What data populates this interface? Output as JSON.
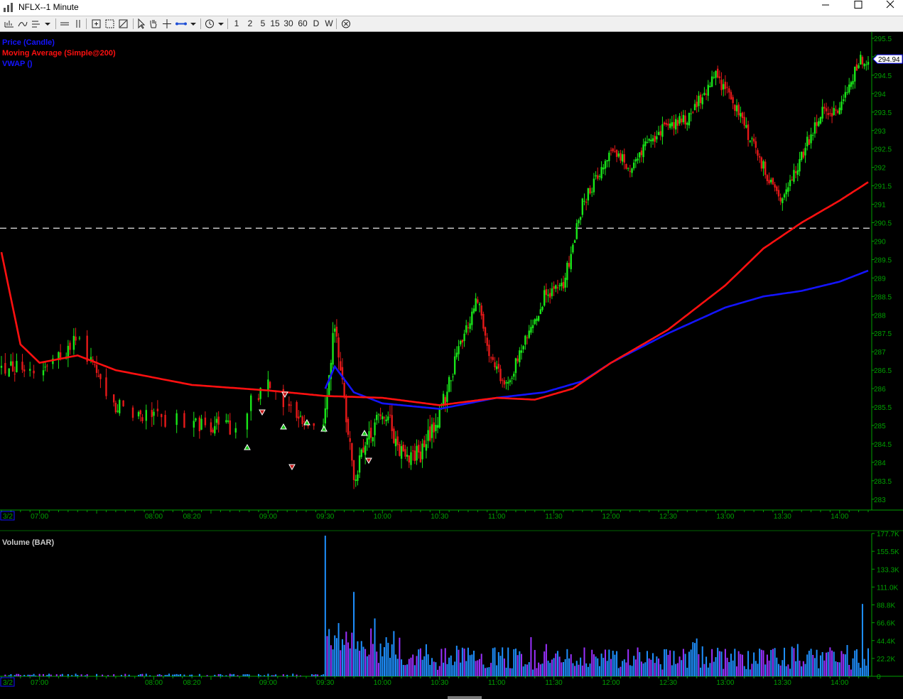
{
  "window": {
    "title": "NFLX--1 Minute"
  },
  "toolbar": {
    "intervals": [
      "1",
      "2",
      "5",
      "15",
      "30",
      "60",
      "D",
      "W"
    ]
  },
  "price_pane": {
    "legend": [
      {
        "label": "Price (Candle)",
        "color": "#1414ff"
      },
      {
        "label": "Moving Average (Simple@200)",
        "color": "#ff1010"
      },
      {
        "label": "VWAP ()",
        "color": "#1414ff"
      }
    ],
    "last_price": "294.94",
    "y_ticks": [
      "295.5",
      "295",
      "294.5",
      "294",
      "293.5",
      "293",
      "292.5",
      "292",
      "291.5",
      "291",
      "290.5",
      "290",
      "289.5",
      "289",
      "288.5",
      "288",
      "287.5",
      "287",
      "286.5",
      "286",
      "285.5",
      "285",
      "284.5",
      "284",
      "283.5",
      "283"
    ],
    "date_label": "3/2",
    "time_ticks": [
      "07:00",
      "08:00",
      "08:20",
      "09:00",
      "09:30",
      "10:00",
      "10:30",
      "11:00",
      "11:30",
      "12:00",
      "12:30",
      "13:00",
      "13:30",
      "14:00"
    ]
  },
  "volume_pane": {
    "title": "Volume (BAR)",
    "y_ticks": [
      "177.7K",
      "155.5K",
      "133.3K",
      "111.0K",
      "88.8K",
      "66.6K",
      "44.4K",
      "22.2K",
      "0"
    ],
    "date_label": "3/2",
    "time_ticks": [
      "07:00",
      "08:00",
      "08:20",
      "09:00",
      "09:30",
      "10:00",
      "10:30",
      "11:00",
      "11:30",
      "12:00",
      "12:30",
      "13:00",
      "13:30",
      "14:00"
    ]
  },
  "colors": {
    "up": "#19e619",
    "down": "#e61919",
    "ma": "#ff1010",
    "vwap": "#1414ff",
    "axis": "#00a000",
    "volume_a": "#1e90ff",
    "volume_b": "#9b30ff",
    "price_flag": "#ffffff"
  },
  "chart_data": {
    "type": "candlestick",
    "symbol": "NFLX",
    "interval": "1 Minute",
    "date": "3/2",
    "price_ylim": [
      282.8,
      295.7
    ],
    "volume_ylim": [
      0,
      177700
    ],
    "last_price": 294.94,
    "horizontal_line": 290.35,
    "price_path": [
      {
        "time": "06:40",
        "price": 286.6
      },
      {
        "time": "07:00",
        "price": 286.6
      },
      {
        "time": "07:20",
        "price": 287.3
      },
      {
        "time": "07:40",
        "price": 285.5
      },
      {
        "time": "08:00",
        "price": 285.2
      },
      {
        "time": "08:20",
        "price": 285.1
      },
      {
        "time": "08:40",
        "price": 284.9
      },
      {
        "time": "09:00",
        "price": 286.2
      },
      {
        "time": "09:20",
        "price": 285.0
      },
      {
        "time": "09:30",
        "price": 285.2
      },
      {
        "time": "09:35",
        "price": 287.8
      },
      {
        "time": "09:45",
        "price": 283.6
      },
      {
        "time": "10:00",
        "price": 285.5
      },
      {
        "time": "10:10",
        "price": 284.3
      },
      {
        "time": "10:20",
        "price": 284.2
      },
      {
        "time": "10:30",
        "price": 285.3
      },
      {
        "time": "10:40",
        "price": 287.0
      },
      {
        "time": "10:50",
        "price": 288.5
      },
      {
        "time": "10:55",
        "price": 287.0
      },
      {
        "time": "11:05",
        "price": 286.0
      },
      {
        "time": "11:15",
        "price": 287.3
      },
      {
        "time": "11:25",
        "price": 288.5
      },
      {
        "time": "11:35",
        "price": 288.8
      },
      {
        "time": "11:45",
        "price": 291.0
      },
      {
        "time": "12:00",
        "price": 292.5
      },
      {
        "time": "12:10",
        "price": 292.0
      },
      {
        "time": "12:25",
        "price": 293.0
      },
      {
        "time": "12:40",
        "price": 293.3
      },
      {
        "time": "12:55",
        "price": 294.5
      },
      {
        "time": "13:05",
        "price": 293.7
      },
      {
        "time": "13:20",
        "price": 292.0
      },
      {
        "time": "13:30",
        "price": 291.0
      },
      {
        "time": "13:40",
        "price": 292.3
      },
      {
        "time": "13:50",
        "price": 293.5
      },
      {
        "time": "14:00",
        "price": 293.5
      },
      {
        "time": "14:10",
        "price": 294.9
      },
      {
        "time": "14:15",
        "price": 294.94
      }
    ],
    "moving_average_200": [
      {
        "time": "06:40",
        "value": 289.7
      },
      {
        "time": "06:50",
        "value": 287.2
      },
      {
        "time": "07:00",
        "value": 286.7
      },
      {
        "time": "07:20",
        "value": 286.9
      },
      {
        "time": "07:40",
        "value": 286.5
      },
      {
        "time": "08:20",
        "value": 286.1
      },
      {
        "time": "09:00",
        "value": 285.95
      },
      {
        "time": "09:30",
        "value": 285.8
      },
      {
        "time": "10:00",
        "value": 285.75
      },
      {
        "time": "10:30",
        "value": 285.55
      },
      {
        "time": "11:00",
        "value": 285.75
      },
      {
        "time": "11:20",
        "value": 285.7
      },
      {
        "time": "11:40",
        "value": 286.0
      },
      {
        "time": "12:00",
        "value": 286.7
      },
      {
        "time": "12:30",
        "value": 287.6
      },
      {
        "time": "13:00",
        "value": 288.8
      },
      {
        "time": "13:20",
        "value": 289.8
      },
      {
        "time": "13:40",
        "value": 290.5
      },
      {
        "time": "14:00",
        "value": 291.1
      },
      {
        "time": "14:15",
        "value": 291.6
      }
    ],
    "vwap": [
      {
        "time": "09:30",
        "value": 286.0
      },
      {
        "time": "09:35",
        "value": 286.6
      },
      {
        "time": "09:45",
        "value": 285.9
      },
      {
        "time": "10:00",
        "value": 285.6
      },
      {
        "time": "10:30",
        "value": 285.45
      },
      {
        "time": "11:00",
        "value": 285.75
      },
      {
        "time": "11:25",
        "value": 285.9
      },
      {
        "time": "11:45",
        "value": 286.2
      },
      {
        "time": "12:00",
        "value": 286.7
      },
      {
        "time": "12:30",
        "value": 287.5
      },
      {
        "time": "13:00",
        "value": 288.2
      },
      {
        "time": "13:20",
        "value": 288.5
      },
      {
        "time": "13:40",
        "value": 288.65
      },
      {
        "time": "14:00",
        "value": 288.9
      },
      {
        "time": "14:15",
        "value": 289.2
      }
    ],
    "volume": [
      {
        "time": "09:30",
        "value": 175000
      },
      {
        "time": "09:45",
        "value": 105000
      },
      {
        "time": "09:56",
        "value": 72000
      },
      {
        "time": "14:12",
        "value": 90000
      }
    ]
  }
}
